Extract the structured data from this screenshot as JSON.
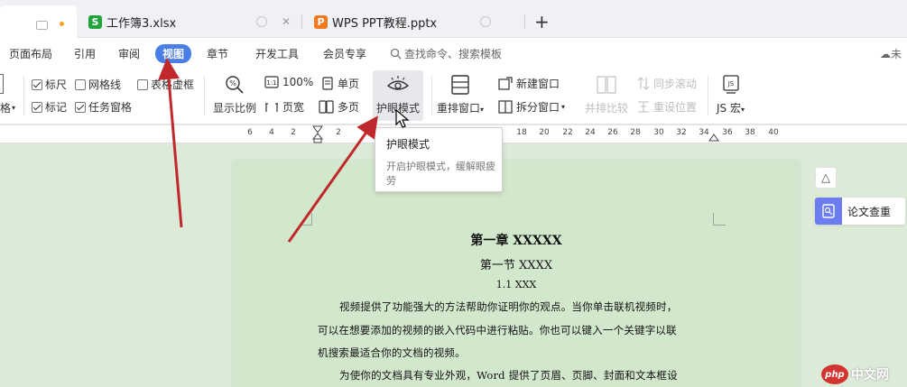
{
  "tabs": [
    {
      "label": "工作簿3.xlsx",
      "app": "S",
      "color": "#1fa33a"
    },
    {
      "label": "WPS PPT教程.pptx",
      "app": "P",
      "color": "#f17a21"
    }
  ],
  "new_tab": "+",
  "menu": {
    "items": [
      "页面布局",
      "引用",
      "审阅",
      "视图",
      "章节",
      "开发工具",
      "会员专享"
    ],
    "active": "视图",
    "search_placeholder": "查找命令、搜索模板",
    "right_text": "未"
  },
  "ribbon": {
    "partial_label": "格",
    "checkboxes": [
      {
        "label": "标尺",
        "checked": true
      },
      {
        "label": "网格线",
        "checked": false
      },
      {
        "label": "表格虚框",
        "checked": false
      },
      {
        "label": "标记",
        "checked": true
      },
      {
        "label": "任务窗格",
        "checked": true
      }
    ],
    "zoom_label": "显示比例",
    "zoom_100": "100%",
    "page_width": "页宽",
    "single_page": "单页",
    "multi_page": "多页",
    "eye_mode": "护眼模式",
    "arrange": "重排窗口",
    "new_window": "新建窗口",
    "split": "拆分窗口",
    "side_by_side": "并排比较",
    "sync_scroll": "同步滚动",
    "reset_pos": "重设位置",
    "js_macro": "JS 宏",
    "js_icon": "JS"
  },
  "ruler": {
    "left_ticks": [
      "6",
      "4",
      "2",
      "2"
    ],
    "right_ticks": [
      "18",
      "20",
      "22",
      "24",
      "26",
      "28",
      "30",
      "32",
      "34",
      "36",
      "38",
      "40"
    ]
  },
  "tooltip": {
    "title": "护眼模式",
    "desc": "开启护眼模式，缓解眼疲劳"
  },
  "document": {
    "chapter": "第一章 XXXXX",
    "section": "第一节 XXXX",
    "subsection": "1.1 XXX",
    "paragraph_lines": [
      "视频提供了功能强大的方法帮助你证明你的观点。当你单击联机视频时，",
      "可以在想要添加的视频的嵌入代码中进行粘贴。你也可以键入一个关键字以联",
      "机搜索最适合你的文档的视频。",
      "为使你的文档具有专业外观，Word 提供了页眉、页脚、封面和文本框设"
    ]
  },
  "side_panel": {
    "up_icon": "△",
    "lunwen_label": "论文查重"
  },
  "watermark": {
    "logo": "php",
    "text": "中文网"
  },
  "colors": {
    "accent": "#4a7de6",
    "page_bg": "#d2e8cc",
    "arrow": "#c0292b"
  }
}
